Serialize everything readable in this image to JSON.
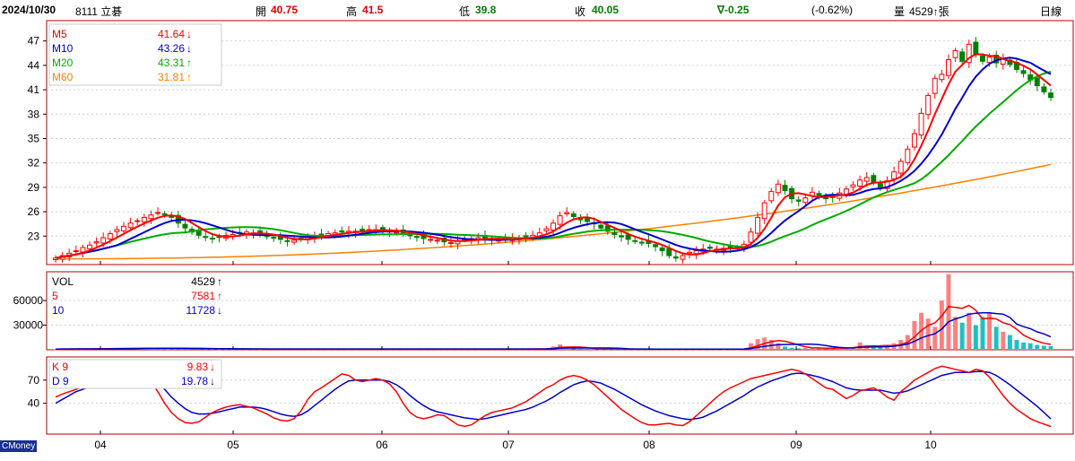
{
  "header": {
    "date": "2024/10/30",
    "stock": "8111 立碁",
    "open_label": "開",
    "open_value": "40.75",
    "high_label": "高",
    "high_value": "41.5",
    "low_label": "低",
    "low_value": "39.8",
    "close_label": "收",
    "close_value": "40.05",
    "change": "∇-0.25",
    "change_pct": "(-0.62%)",
    "volume_label": "量",
    "volume_value": "4529↑張",
    "period": "日線"
  },
  "brand": "CMoney",
  "colors": {
    "up": "#ff0000",
    "down": "#008000",
    "ma5": "#ff0000",
    "ma10": "#0000cc",
    "ma20": "#00aa00",
    "ma60": "#ff8000",
    "vol_up": "#ff8080",
    "vol_down": "#20c0c0",
    "k": "#ff0000",
    "d": "#0000cc",
    "frame": "#b00000"
  },
  "chart_data": [
    {
      "type": "candlestick",
      "panel": "price",
      "x_axis": {
        "tick_labels": [
          "04",
          "05",
          "06",
          "07",
          "08",
          "09",
          "10"
        ]
      },
      "y_axis": {
        "ticks": [
          23,
          26,
          29,
          32,
          35,
          38,
          41,
          44,
          47
        ],
        "ylim": [
          19.5,
          49.5
        ]
      },
      "legend": [
        {
          "name": "M5",
          "value": "41.64",
          "arrow": "↓"
        },
        {
          "name": "M10",
          "value": "43.26",
          "arrow": "↓"
        },
        {
          "name": "M20",
          "value": "43.31",
          "arrow": "↑"
        },
        {
          "name": "M60",
          "value": "31.81",
          "arrow": "↑"
        }
      ],
      "close_prices": [
        20.3,
        20.6,
        20.9,
        21.2,
        21.6,
        21.9,
        22.3,
        22.8,
        23.3,
        23.8,
        24.2,
        24.6,
        24.9,
        25.3,
        25.6,
        25.9,
        25.7,
        25.3,
        24.6,
        24.0,
        23.5,
        23.1,
        22.9,
        22.7,
        22.9,
        23.1,
        23.2,
        23.4,
        23.5,
        23.4,
        23.2,
        23.0,
        22.8,
        22.6,
        22.4,
        22.5,
        22.7,
        22.9,
        23.0,
        23.2,
        23.3,
        23.4,
        23.5,
        23.6,
        23.6,
        23.7,
        23.8,
        23.8,
        23.7,
        23.6,
        23.5,
        23.3,
        23.1,
        22.9,
        22.7,
        22.6,
        22.5,
        22.3,
        22.2,
        22.4,
        22.6,
        22.7,
        22.8,
        22.7,
        22.6,
        22.5,
        22.6,
        22.7,
        22.8,
        22.9,
        23.1,
        23.4,
        23.9,
        24.6,
        25.5,
        25.9,
        25.4,
        25.0,
        24.8,
        24.5,
        24.0,
        23.6,
        23.2,
        22.9,
        22.6,
        22.4,
        22.2,
        22.1,
        21.7,
        21.2,
        20.6,
        20.3,
        20.6,
        21.0,
        21.2,
        21.4,
        21.5,
        21.4,
        21.5,
        21.6,
        21.6,
        22.0,
        23.5,
        25.3,
        27.1,
        28.5,
        29.4,
        28.6,
        27.6,
        27.3,
        27.7,
        28.4,
        28.0,
        27.6,
        27.8,
        28.3,
        28.8,
        29.3,
        29.9,
        30.2,
        29.6,
        29.0,
        29.8,
        30.9,
        32.2,
        33.7,
        35.6,
        38.1,
        40.3,
        42.4,
        42.9,
        44.7,
        45.8,
        44.5,
        46.6,
        45.3,
        44.5,
        45.0,
        44.3,
        44.8,
        44.1,
        43.5,
        43.0,
        42.2,
        41.5,
        40.75,
        40.05
      ],
      "ma5_last": 41.64,
      "ma10_last": 43.26,
      "ma20_last": 43.31,
      "ma60_last": 31.81
    },
    {
      "type": "bar",
      "panel": "volume",
      "y_axis": {
        "ticks": [
          30000,
          60000
        ],
        "ylim": [
          0,
          95000
        ]
      },
      "legend": [
        {
          "name": "VOL",
          "value": "4529",
          "arrow": "↑"
        },
        {
          "name": "5",
          "value": "7581",
          "arrow": "↑"
        },
        {
          "name": "10",
          "value": "11728",
          "arrow": "↓"
        }
      ],
      "values": [
        900,
        1000,
        1100,
        1200,
        1100,
        1300,
        1400,
        1500,
        1600,
        1700,
        1800,
        1900,
        2000,
        2100,
        2000,
        1900,
        1800,
        1700,
        1600,
        1500,
        1400,
        1300,
        1200,
        1100,
        1000,
        1000,
        1000,
        1000,
        1000,
        1000,
        1000,
        1000,
        1000,
        1000,
        1000,
        1000,
        1000,
        1000,
        1000,
        1000,
        1000,
        1000,
        1000,
        1000,
        1000,
        1000,
        1000,
        1000,
        1000,
        1000,
        1000,
        1000,
        1000,
        1000,
        1000,
        1000,
        1000,
        1000,
        1000,
        1000,
        1000,
        1000,
        1000,
        1000,
        1000,
        1000,
        1000,
        1000,
        1000,
        1000,
        1000,
        1200,
        1800,
        4000,
        6500,
        3000,
        1500,
        1200,
        1100,
        1000,
        900,
        900,
        900,
        900,
        900,
        900,
        900,
        900,
        900,
        900,
        900,
        900,
        900,
        900,
        900,
        900,
        900,
        900,
        900,
        900,
        900,
        1500,
        8000,
        13000,
        15000,
        12000,
        8000,
        4000,
        2500,
        1800,
        2000,
        2500,
        2000,
        1800,
        1900,
        2200,
        2500,
        3500,
        9000,
        5000,
        4000,
        3000,
        5000,
        8000,
        12000,
        18000,
        35000,
        45000,
        38000,
        28000,
        60000,
        92000,
        40000,
        33000,
        45000,
        30000,
        40000,
        45000,
        28000,
        22000,
        18000,
        12000,
        9000,
        8000,
        6000,
        5000,
        4529
      ],
      "ma5_last": 7581,
      "ma10_last": 11728
    },
    {
      "type": "line",
      "panel": "kd",
      "y_axis": {
        "ticks": [
          40,
          70
        ],
        "ylim": [
          0,
          100
        ]
      },
      "legend": [
        {
          "name": "K 9",
          "value": "9.83",
          "arrow": "↓"
        },
        {
          "name": "D 9",
          "value": "19.78",
          "arrow": "↓"
        }
      ],
      "series": [
        {
          "name": "K 9",
          "values": [
            48,
            52,
            55,
            58,
            61,
            64,
            67,
            70,
            72,
            74,
            76,
            78,
            80,
            75,
            68,
            55,
            40,
            28,
            20,
            15,
            14,
            16,
            22,
            28,
            32,
            35,
            37,
            38,
            36,
            34,
            30,
            26,
            21,
            18,
            17,
            20,
            30,
            45,
            55,
            60,
            66,
            72,
            78,
            76,
            70,
            68,
            70,
            72,
            70,
            65,
            55,
            40,
            28,
            22,
            20,
            22,
            25,
            24,
            18,
            12,
            10,
            12,
            18,
            24,
            28,
            30,
            32,
            34,
            38,
            42,
            48,
            54,
            60,
            64,
            70,
            74,
            76,
            74,
            70,
            64,
            56,
            48,
            40,
            32,
            26,
            20,
            15,
            12,
            12,
            13,
            14,
            12,
            11,
            16,
            24,
            32,
            40,
            48,
            55,
            60,
            64,
            68,
            72,
            74,
            76,
            78,
            80,
            82,
            84,
            82,
            78,
            72,
            66,
            60,
            58,
            52,
            46,
            50,
            56,
            58,
            60,
            55,
            48,
            44,
            55,
            62,
            70,
            75,
            80,
            85,
            88,
            86,
            84,
            82,
            80,
            84,
            82,
            74,
            62,
            50,
            40,
            32,
            26,
            20,
            16,
            13,
            9.83
          ]
        },
        {
          "name": "D 9",
          "values": [
            40,
            45,
            50,
            55,
            58,
            61,
            64,
            66,
            68,
            70,
            72,
            74,
            76,
            75,
            72,
            66,
            58,
            48,
            40,
            33,
            28,
            26,
            26,
            27,
            29,
            31,
            33,
            35,
            35,
            35,
            34,
            32,
            29,
            26,
            24,
            23,
            25,
            30,
            37,
            44,
            51,
            58,
            64,
            69,
            70,
            70,
            70,
            70,
            70,
            68,
            64,
            58,
            50,
            43,
            37,
            32,
            29,
            27,
            25,
            23,
            21,
            20,
            19,
            20,
            22,
            24,
            26,
            28,
            30,
            32,
            35,
            39,
            43,
            48,
            54,
            59,
            64,
            67,
            69,
            68,
            66,
            62,
            58,
            53,
            48,
            43,
            38,
            34,
            30,
            27,
            24,
            22,
            20,
            19,
            20,
            22,
            26,
            30,
            35,
            40,
            45,
            50,
            56,
            61,
            65,
            69,
            72,
            75,
            78,
            79,
            78,
            76,
            74,
            71,
            68,
            64,
            60,
            58,
            57,
            57,
            57,
            57,
            55,
            53,
            54,
            56,
            60,
            64,
            68,
            72,
            76,
            78,
            80,
            80,
            80,
            81,
            81,
            80,
            76,
            70,
            64,
            57,
            50,
            43,
            36,
            28,
            19.78
          ]
        }
      ]
    }
  ]
}
